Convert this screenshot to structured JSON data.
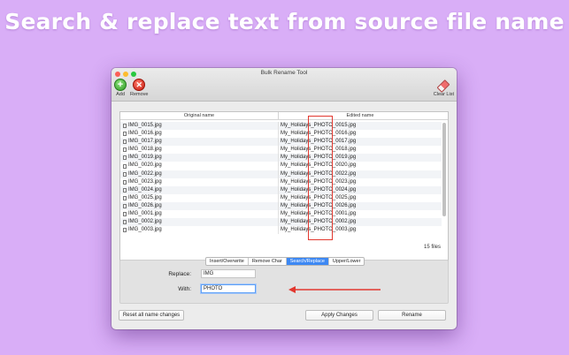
{
  "headline": "Search & replace text from source file name",
  "window": {
    "title": "Bulk Rename Tool",
    "toolbar": {
      "add_label": "Add",
      "remove_label": "Remove",
      "clear_label": "Clear List",
      "add_icon": "plus-icon",
      "remove_icon": "x-icon",
      "clear_icon": "eraser-icon"
    },
    "table": {
      "headers": [
        "Original name",
        "Edited name"
      ],
      "rows": [
        {
          "original": "IMG_0015.jpg",
          "edited": "My_Holidays_PHOTO_0015.jpg"
        },
        {
          "original": "IMG_0016.jpg",
          "edited": "My_Holidays_PHOTO_0016.jpg"
        },
        {
          "original": "IMG_0017.jpg",
          "edited": "My_Holidays_PHOTO_0017.jpg"
        },
        {
          "original": "IMG_0018.jpg",
          "edited": "My_Holidays_PHOTO_0018.jpg"
        },
        {
          "original": "IMG_0019.jpg",
          "edited": "My_Holidays_PHOTO_0019.jpg"
        },
        {
          "original": "IMG_0020.jpg",
          "edited": "My_Holidays_PHOTO_0020.jpg"
        },
        {
          "original": "IMG_0022.jpg",
          "edited": "My_Holidays_PHOTO_0022.jpg"
        },
        {
          "original": "IMG_0023.jpg",
          "edited": "My_Holidays_PHOTO_0023.jpg"
        },
        {
          "original": "IMG_0024.jpg",
          "edited": "My_Holidays_PHOTO_0024.jpg"
        },
        {
          "original": "IMG_0025.jpg",
          "edited": "My_Holidays_PHOTO_0025.jpg"
        },
        {
          "original": "IMG_0026.jpg",
          "edited": "My_Holidays_PHOTO_0026.jpg"
        },
        {
          "original": "IMG_0001.jpg",
          "edited": "My_Holidays_PHOTO_0001.jpg"
        },
        {
          "original": "IMG_0002.jpg",
          "edited": "My_Holidays_PHOTO_0002.jpg"
        },
        {
          "original": "IMG_0003.jpg",
          "edited": "My_Holidays_PHOTO_0003.jpg"
        }
      ],
      "file_count": "15 files"
    },
    "tabs": [
      {
        "label": "Insert/Overwrite",
        "active": false
      },
      {
        "label": "Remove Char",
        "active": false
      },
      {
        "label": "Search/Replace",
        "active": true
      },
      {
        "label": "Upper/Lower",
        "active": false
      }
    ],
    "form": {
      "replace_label": "Replace:",
      "replace_value": "IMG",
      "with_label": "With:",
      "with_value": "PHOTO"
    },
    "buttons": {
      "reset": "Reset all name changes",
      "apply": "Apply Changes",
      "rename": "Rename"
    }
  },
  "colors": {
    "background": "#d9aef7",
    "accent": "#3d88f3",
    "annotation": "#e2382f"
  }
}
